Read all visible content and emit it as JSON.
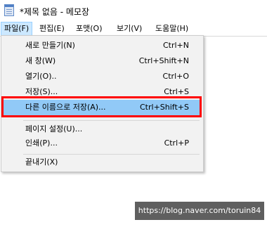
{
  "window": {
    "title": "*제목 없음 - 메모장"
  },
  "menubar": {
    "items": [
      {
        "label": "파일(F)"
      },
      {
        "label": "편집(E)"
      },
      {
        "label": "포맷(O)"
      },
      {
        "label": "보기(V)"
      },
      {
        "label": "도움말(H)"
      }
    ]
  },
  "file_menu": {
    "items": [
      {
        "label": "새로 만들기(N)",
        "shortcut": "Ctrl+N"
      },
      {
        "label": "새 창(W)",
        "shortcut": "Ctrl+Shift+N"
      },
      {
        "label": "열기(O)..",
        "shortcut": "Ctrl+O"
      },
      {
        "label": "저장(S)...",
        "shortcut": "Ctrl+S"
      },
      {
        "label": "다른 이름으로 저장(A)...",
        "shortcut": "Ctrl+Shift+S"
      },
      {
        "label": "페이지 설정(U)...",
        "shortcut": ""
      },
      {
        "label": "인쇄(P)...",
        "shortcut": "Ctrl+P"
      },
      {
        "label": "끝내기(X)",
        "shortcut": ""
      }
    ]
  },
  "watermark": {
    "text": "https://blog.naver.com/toruin84"
  },
  "colors": {
    "menu_highlight": "#91c9f7",
    "annotation_box": "#ff0000",
    "menubar_active": "#cce8ff"
  }
}
